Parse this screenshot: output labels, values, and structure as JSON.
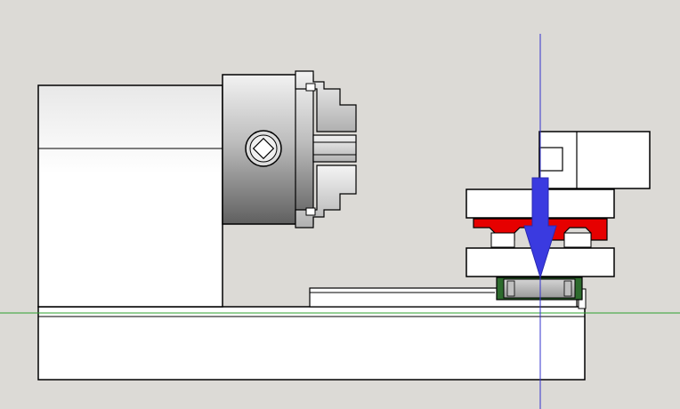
{
  "scene": {
    "title": "",
    "objects": [
      {
        "name": "headstock",
        "icon": "lathe-headstock"
      },
      {
        "name": "chuck",
        "icon": "three-jaw-chuck"
      },
      {
        "name": "lathe-bed",
        "icon": "lathe-bed"
      },
      {
        "name": "guide-rail",
        "icon": "linear-rail"
      },
      {
        "name": "tool-post",
        "icon": "tool-post-assembly"
      },
      {
        "name": "direction-arrow",
        "icon": "arrow-down-icon"
      },
      {
        "name": "axis-vertical",
        "icon": "axis-line"
      },
      {
        "name": "axis-horizontal",
        "icon": "axis-line"
      }
    ]
  },
  "colors": {
    "background": "#dcdad6",
    "outline": "#000000",
    "part_fill": "#ffffff",
    "chuck_light": "#f2f2f2",
    "chuck_dark": "#5f5f5f",
    "clamp_red": "#e60000",
    "arrow_blue": "#3a3ae0",
    "axis_blue": "#3333cc",
    "axis_green": "#2ea02e",
    "bearing_green": "#2e6b2e",
    "bearing_grey": "#b8b8b8"
  }
}
